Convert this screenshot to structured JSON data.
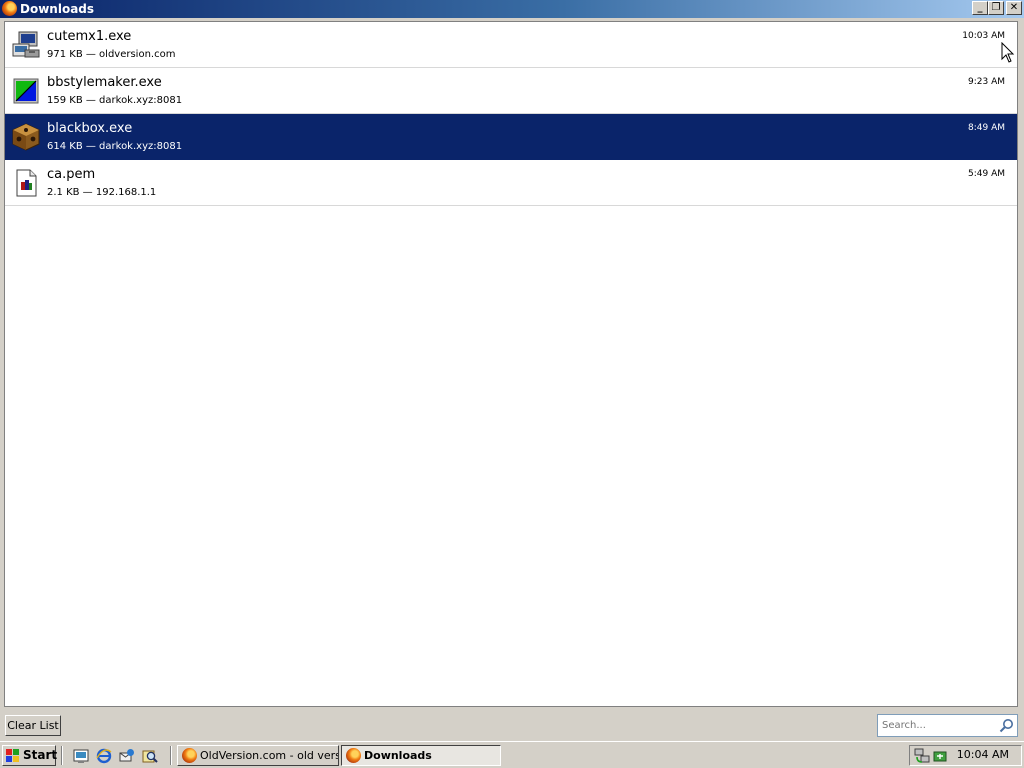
{
  "window": {
    "title": "Downloads",
    "buttons": {
      "minimize": "_",
      "maximize": "❐",
      "close": "✕"
    }
  },
  "downloads": [
    {
      "name": "cutemx1.exe",
      "meta": "971 KB — oldversion.com",
      "time": "10:03 AM",
      "icon": "installer-icon",
      "selected": false
    },
    {
      "name": "bbstylemaker.exe",
      "meta": "159 KB — darkok.xyz:8081",
      "time": "9:23 AM",
      "icon": "app-icon",
      "selected": false
    },
    {
      "name": "blackbox.exe",
      "meta": "614 KB — darkok.xyz:8081",
      "time": "8:49 AM",
      "icon": "box-icon",
      "selected": true
    },
    {
      "name": "ca.pem",
      "meta": "2.1 KB — 192.168.1.1",
      "time": "5:49 AM",
      "icon": "certificate-file-icon",
      "selected": false
    }
  ],
  "toolbar": {
    "clear_label": "Clear List",
    "search_placeholder": "Search..."
  },
  "taskbar": {
    "start_label": "Start",
    "tasks": [
      {
        "label": "OldVersion.com - old versi...",
        "active": false
      },
      {
        "label": "Downloads",
        "active": true
      }
    ],
    "clock": "10:04 AM"
  },
  "colors": {
    "selection": "#0a246a",
    "titlebar_start": "#0a246a",
    "titlebar_end": "#a6caf0",
    "chrome": "#d4d0c8"
  }
}
